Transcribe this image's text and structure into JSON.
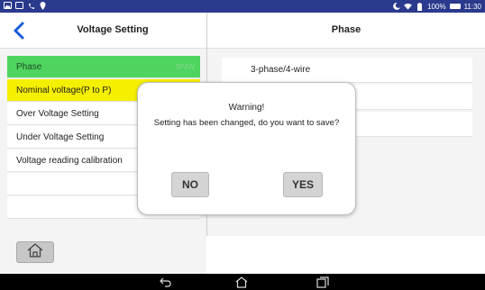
{
  "status_bar": {
    "battery": "100%",
    "time": "11:30",
    "icons": [
      "gallery-icon",
      "message-icon",
      "phone-icon",
      "location-icon",
      "moon-icon",
      "wifi-icon",
      "battery-saver-icon",
      "battery-icon"
    ]
  },
  "header": {
    "left_title": "Voltage Setting",
    "right_title": "Phase"
  },
  "left_menu": {
    "items": [
      {
        "label": "Phase",
        "hint": "3P4W",
        "state": "selected-green"
      },
      {
        "label": "Nominal voltage(P to P)",
        "state": "highlighted-yellow"
      },
      {
        "label": "Over Voltage Setting"
      },
      {
        "label": "Under Voltage Setting"
      },
      {
        "label": "Voltage reading calibration"
      },
      {
        "label": ""
      },
      {
        "label": ""
      }
    ]
  },
  "right_options": {
    "items": [
      {
        "label": "3-phase/4-wire"
      },
      {
        "label": ""
      },
      {
        "label": ""
      }
    ]
  },
  "dialog": {
    "title": "Warning!",
    "message": "Setting has been changed, do you want to save?",
    "no_label": "NO",
    "yes_label": "YES"
  },
  "nav_bar": {
    "buttons": [
      "back-icon",
      "home-icon",
      "recents-icon"
    ]
  },
  "colors": {
    "status_bar": "#2a3a8c",
    "selected_green": "#4fd45f",
    "highlight_yellow": "#f5f000",
    "accent_blue": "#1a5bd8"
  }
}
